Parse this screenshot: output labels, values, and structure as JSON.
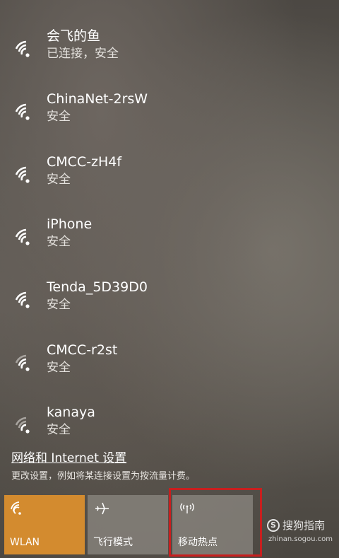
{
  "networks": [
    {
      "ssid": "会飞的鱼",
      "status": "已连接，安全",
      "signal": "full"
    },
    {
      "ssid": "ChinaNet-2rsW",
      "status": "安全",
      "signal": "full"
    },
    {
      "ssid": "CMCC-zH4f",
      "status": "安全",
      "signal": "full"
    },
    {
      "ssid": "iPhone",
      "status": "安全",
      "signal": "full"
    },
    {
      "ssid": "Tenda_5D39D0",
      "status": "安全",
      "signal": "full"
    },
    {
      "ssid": "CMCC-r2st",
      "status": "安全",
      "signal": "weak"
    },
    {
      "ssid": "kanaya",
      "status": "安全",
      "signal": "weak"
    }
  ],
  "settings": {
    "link_label": "网络和 Internet 设置",
    "description": "更改设置，例如将某连接设置为按流量计费。"
  },
  "quick_actions": {
    "wlan": {
      "label": "WLAN",
      "icon": "wifi-icon",
      "active": true
    },
    "airplane": {
      "label": "飞行模式",
      "icon": "airplane-icon",
      "active": false
    },
    "hotspot": {
      "label": "移动热点",
      "icon": "hotspot-icon",
      "active": false
    }
  },
  "watermark": {
    "brand": "搜狗指南",
    "url": "zhinan.sogou.com"
  },
  "colors": {
    "accent": "#d38b2f",
    "highlight": "#c81f1f"
  }
}
